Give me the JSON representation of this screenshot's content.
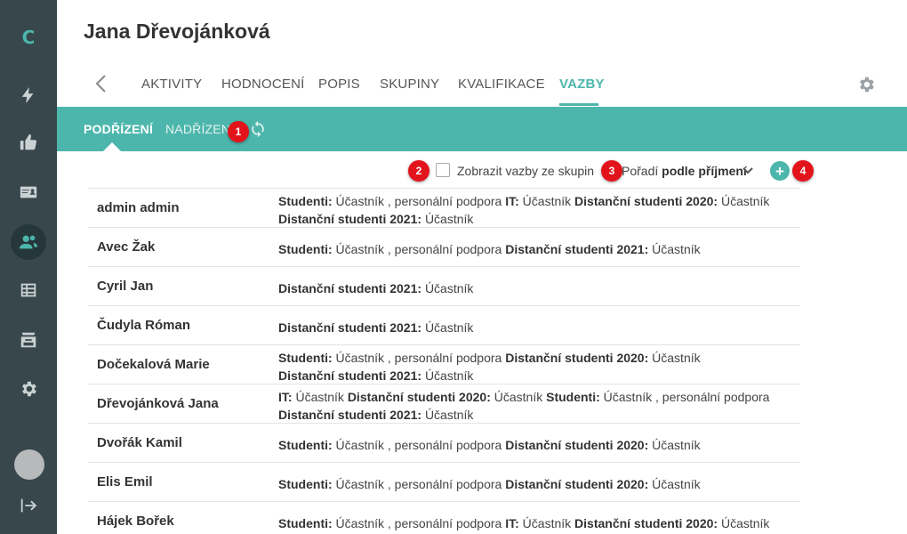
{
  "sidebar": {
    "logo": "C",
    "icons": [
      "bolt-icon",
      "thumbs-up-icon",
      "id-card-icon",
      "users-icon",
      "table-icon",
      "archive-icon",
      "gear-icon",
      "logout-icon"
    ],
    "active": "users-icon"
  },
  "header": {
    "title": "Jana Dřevojánková",
    "tabs": [
      "AKTIVITY",
      "HODNOCENÍ",
      "POPIS",
      "SKUPINY",
      "KVALIFIKACE",
      "VAZBY"
    ],
    "active_tab": "VAZBY"
  },
  "subtabs": {
    "items": [
      "PODŘÍZENÍ",
      "NADŘÍZENÍ"
    ],
    "active": "PODŘÍZENÍ"
  },
  "badges": [
    "1",
    "2",
    "3",
    "4"
  ],
  "toolbar": {
    "checkbox_label": "Zobrazit vazby ze skupin",
    "checkbox_checked": false,
    "order_label": "Pořadí",
    "order_value": "podle příjmení",
    "add_label": "+"
  },
  "rows": [
    {
      "name": "admin admin",
      "lines": [
        [
          [
            "Studenti:",
            "Účastník , personální podpora"
          ],
          [
            "IT:",
            "Účastník"
          ],
          [
            "Distanční studenti 2020:",
            "Účastník"
          ]
        ],
        [
          [
            "Distanční studenti 2021:",
            "Účastník"
          ]
        ]
      ]
    },
    {
      "name": "Avec Žak",
      "lines": [
        [
          [
            "Studenti:",
            "Účastník , personální podpora"
          ],
          [
            "Distanční studenti 2021:",
            "Účastník"
          ]
        ]
      ]
    },
    {
      "name": "Cyril Jan",
      "lines": [
        [
          [
            "Distanční studenti 2021:",
            "Účastník"
          ]
        ]
      ]
    },
    {
      "name": "Čudyla Róman",
      "lines": [
        [
          [
            "Distanční studenti 2021:",
            "Účastník"
          ]
        ]
      ]
    },
    {
      "name": "Dočekalová Marie",
      "lines": [
        [
          [
            "Studenti:",
            "Účastník , personální podpora"
          ],
          [
            "Distanční studenti 2020:",
            "Účastník"
          ]
        ],
        [
          [
            "Distanční studenti 2021:",
            "Účastník"
          ]
        ]
      ]
    },
    {
      "name": "Dřevojánková Jana",
      "lines": [
        [
          [
            "IT:",
            "Účastník"
          ],
          [
            "Distanční studenti 2020:",
            "Účastník"
          ],
          [
            "Studenti:",
            "Účastník , personální podpora"
          ]
        ],
        [
          [
            "Distanční studenti 2021:",
            "Účastník"
          ]
        ]
      ]
    },
    {
      "name": "Dvořák Kamil",
      "lines": [
        [
          [
            "Studenti:",
            "Účastník , personální podpora"
          ],
          [
            "Distanční studenti 2020:",
            "Účastník"
          ]
        ]
      ]
    },
    {
      "name": "Elis Emil",
      "lines": [
        [
          [
            "Studenti:",
            "Účastník , personální podpora"
          ],
          [
            "Distanční studenti 2020:",
            "Účastník"
          ]
        ]
      ]
    },
    {
      "name": "Hájek Bořek",
      "lines": [
        [
          [
            "Studenti:",
            "Účastník , personální podpora"
          ],
          [
            "IT:",
            "Účastník"
          ],
          [
            "Distanční studenti 2020:",
            "Účastník"
          ]
        ]
      ]
    }
  ]
}
